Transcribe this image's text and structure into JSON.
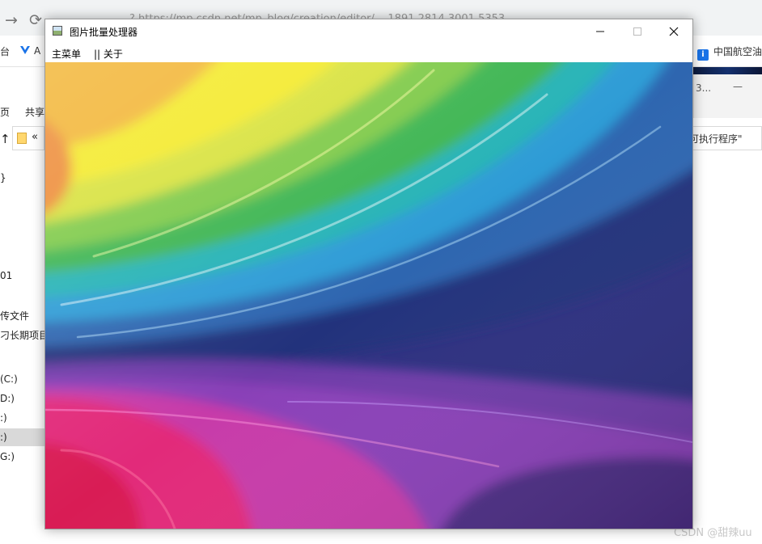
{
  "background_browser": {
    "url_fragment": "? https://mp.csdn.net/mp_blog/creation/editor/...  1891 2814 3001 5353",
    "bookmarks": [
      {
        "label": "台"
      },
      {
        "label": "A"
      },
      {
        "label": "中国航空油"
      }
    ]
  },
  "background_explorer": {
    "tab_fragment": "3...",
    "menu_items": [
      "页",
      "共享"
    ],
    "search_fragment": "可执行程序\"",
    "sidebar_items": [
      "}",
      "01",
      "传文件",
      "刁长期项目",
      "(C:)",
      "D:)",
      ":)",
      ":)",
      "G:)"
    ]
  },
  "window": {
    "title": "图片批量处理器",
    "menu": {
      "main_menu": "主菜单",
      "about": "|| 关于"
    },
    "controls": {
      "minimize": "—",
      "maximize": "☐",
      "close": "✕"
    },
    "image_description": "rainbow swirl image"
  },
  "watermark": "CSDN @甜辣uu"
}
